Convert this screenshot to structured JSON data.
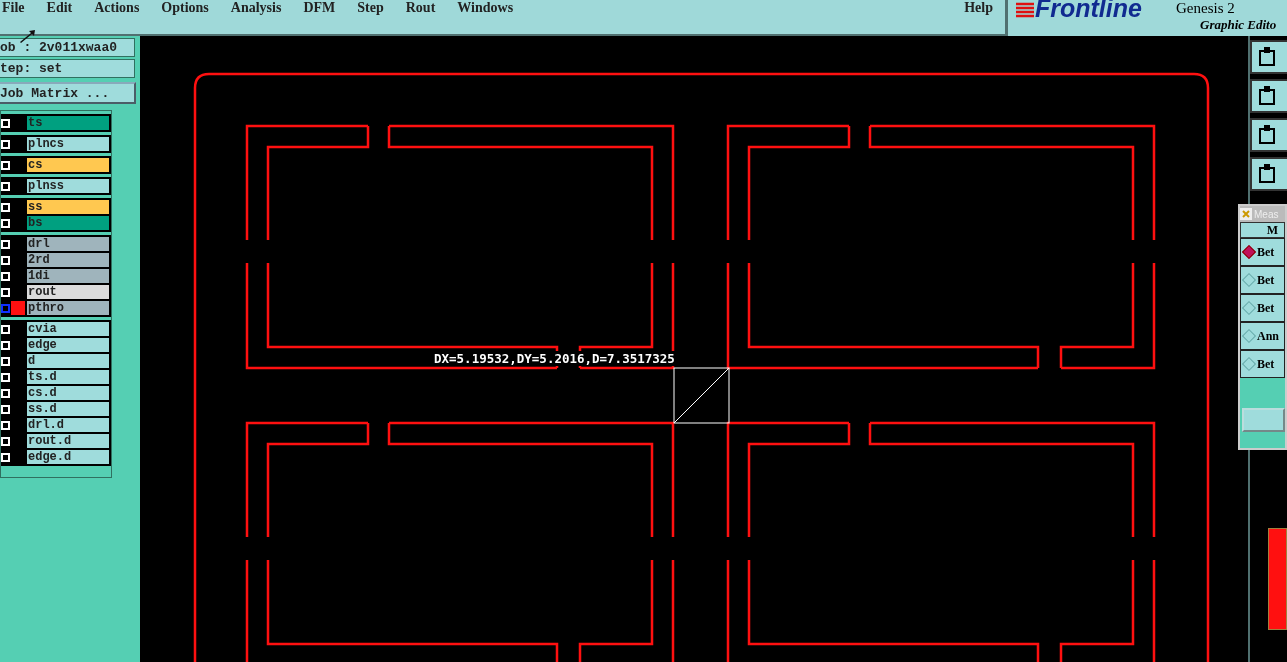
{
  "menu": [
    {
      "label": "File"
    },
    {
      "label": "Edit"
    },
    {
      "label": "Actions"
    },
    {
      "label": "Options"
    },
    {
      "label": "Analysis"
    },
    {
      "label": "DFM"
    },
    {
      "label": "Step"
    },
    {
      "label": "Rout"
    },
    {
      "label": "Windows"
    }
  ],
  "help": "Help",
  "brand": {
    "logo": "Frontline",
    "title": "Genesis 2",
    "subtitle": "Graphic Edito"
  },
  "job": "ob : 2v011xwaa0",
  "step": "tep: set",
  "job_matrix_button": "Job Matrix ...",
  "layer_groups": [
    {
      "layers": [
        {
          "name": "ts",
          "color": "#00a080",
          "selected": false,
          "checked": false
        }
      ]
    },
    {
      "layers": [
        {
          "name": "plncs",
          "color": "#9fdcdc",
          "selected": false,
          "checked": false
        }
      ]
    },
    {
      "layers": [
        {
          "name": "cs",
          "color": "#ffc850",
          "selected": false,
          "checked": false
        }
      ]
    },
    {
      "layers": [
        {
          "name": "plnss",
          "color": "#9fdcdc",
          "selected": false,
          "checked": false
        }
      ]
    },
    {
      "layers": [
        {
          "name": "ss",
          "color": "#ffc850",
          "selected": false,
          "checked": false
        },
        {
          "name": "bs",
          "color": "#00a080",
          "selected": false,
          "checked": false
        }
      ]
    },
    {
      "layers": [
        {
          "name": "drl",
          "color": "#9fb4bc",
          "selected": false,
          "checked": false
        },
        {
          "name": "2rd",
          "color": "#9fb4bc",
          "selected": false,
          "checked": false
        },
        {
          "name": "1di",
          "color": "#9fb4bc",
          "selected": false,
          "checked": false
        },
        {
          "name": "rout",
          "color": "#dcdcdc",
          "selected": false,
          "checked": false
        },
        {
          "name": "pthro",
          "color": "#9fb4bc",
          "selected": true,
          "checked": false
        }
      ]
    },
    {
      "layers": [
        {
          "name": "cvia",
          "color": "#9fdcdc",
          "selected": false,
          "checked": false
        },
        {
          "name": "edge",
          "color": "#9fdcdc",
          "selected": false,
          "checked": false
        },
        {
          "name": "d",
          "color": "#9fdcdc",
          "selected": false,
          "checked": false
        },
        {
          "name": "ts.d",
          "color": "#9fdcdc",
          "selected": false,
          "checked": false
        },
        {
          "name": "cs.d",
          "color": "#9fdcdc",
          "selected": false,
          "checked": false
        },
        {
          "name": "ss.d",
          "color": "#9fdcdc",
          "selected": false,
          "checked": false
        },
        {
          "name": "drl.d",
          "color": "#9fdcdc",
          "selected": false,
          "checked": false
        },
        {
          "name": "rout.d",
          "color": "#9fdcdc",
          "selected": false,
          "checked": false
        },
        {
          "name": "edge.d",
          "color": "#9fdcdc",
          "selected": false,
          "checked": false
        }
      ]
    }
  ],
  "measurement": "DX=5.19532,DY=5.2016,D=7.3517325",
  "measure_dialog": {
    "title": "Meas",
    "header": "M",
    "options": [
      {
        "label": "Bet",
        "selected": true
      },
      {
        "label": "Bet",
        "selected": false
      },
      {
        "label": "Bet",
        "selected": false
      },
      {
        "label": "Ann",
        "selected": false
      },
      {
        "label": "Bet",
        "selected": false
      }
    ]
  }
}
